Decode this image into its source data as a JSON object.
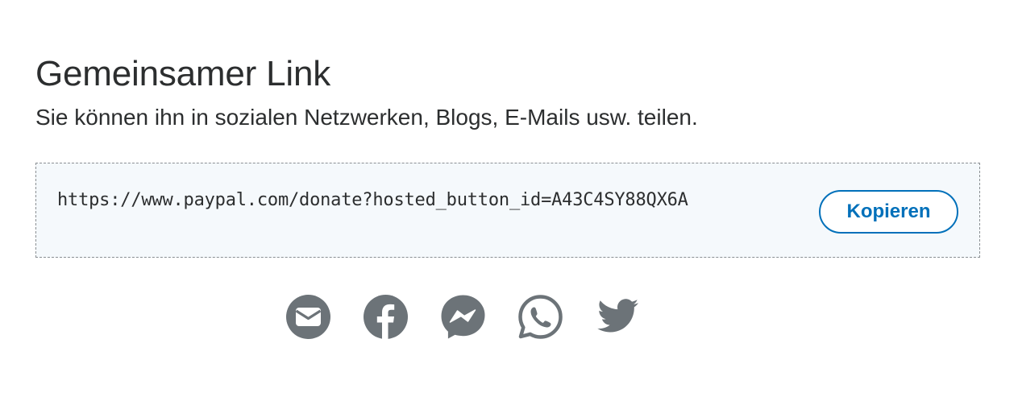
{
  "share": {
    "title": "Gemeinsamer Link",
    "subtitle": "Sie können ihn in sozialen Netzwerken, Blogs, E-Mails usw. teilen.",
    "link": "https://www.paypal.com/donate?hosted_button_id=A43C4SY88QX6A",
    "copy_label": "Kopieren",
    "icons": [
      "email-icon",
      "facebook-icon",
      "messenger-icon",
      "whatsapp-icon",
      "twitter-icon"
    ]
  },
  "colors": {
    "accent": "#0070ba",
    "icon": "#6c7378",
    "box_background": "#f5f9fc",
    "text": "#2c2e2f"
  }
}
